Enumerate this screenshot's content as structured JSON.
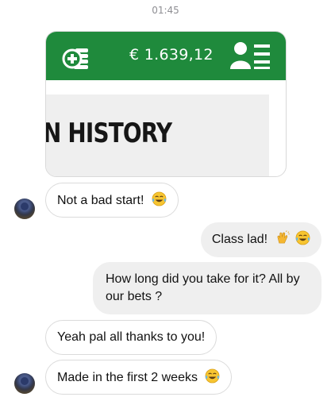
{
  "status_bar": {
    "time": "01:45"
  },
  "shared_image": {
    "balance": "€ 1.639,12",
    "heading": "N HISTORY",
    "header_color": "#1f8a3c",
    "icons": [
      "coins-plus-icon",
      "profile-list-icon"
    ]
  },
  "messages": [
    {
      "side": "incoming",
      "text": "Not a bad start!",
      "emoji": "tears-of-joy-emoji"
    },
    {
      "side": "outgoing",
      "text": "Class lad!",
      "emoji": "clapping-hands-emoji"
    },
    {
      "side": "outgoing",
      "text": "How long did you take for it? All by our bets ?"
    },
    {
      "side": "incoming",
      "text": "Yeah pal all thanks to you!"
    },
    {
      "side": "incoming",
      "text": "Made in the first 2 weeks",
      "emoji": "tears-of-joy-emoji"
    }
  ]
}
